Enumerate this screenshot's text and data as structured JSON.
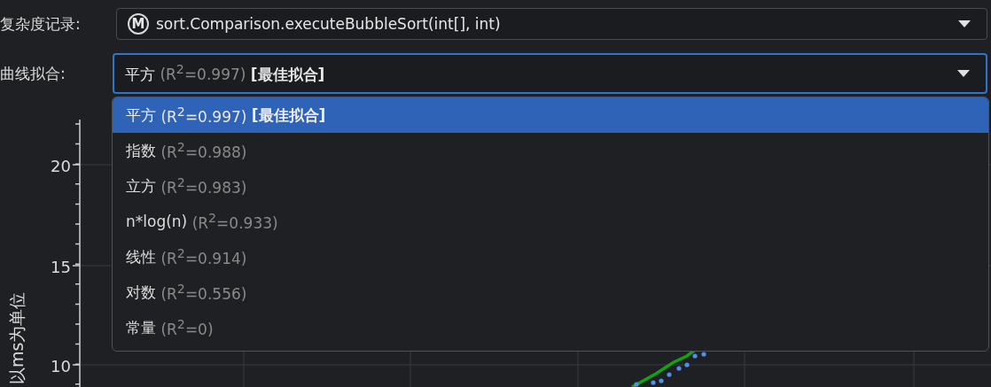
{
  "complexity_record": {
    "label": "复杂度记录:",
    "icon_letter": "M",
    "value": "sort.Comparison.executeBubbleSort(int[], int)"
  },
  "curve_fit": {
    "label": "曲线拟合:",
    "focused": true,
    "value": {
      "name": "平方",
      "fit": "(R$^{2}$=0.997)",
      "tag": "[最佳拟合]"
    },
    "options": [
      {
        "name": "平方",
        "fit": "(R$^{2}$=0.997)",
        "tag": "[最佳拟合]",
        "selected": true
      },
      {
        "name": "指数",
        "fit": "(R$^{2}$=0.988)",
        "selected": false
      },
      {
        "name": "立方",
        "fit": "(R$^{2}$=0.983)",
        "selected": false
      },
      {
        "name": "n*log(n)",
        "fit": "(R$^{2}$=0.933)",
        "selected": false
      },
      {
        "name": "线性",
        "fit": "(R$^{2}$=0.914)",
        "selected": false
      },
      {
        "name": "对数",
        "fit": "(R$^{2}$=0.556)",
        "selected": false
      },
      {
        "name": "常量",
        "fit": "(R$^{2}$=0)",
        "selected": false
      }
    ]
  },
  "chart": {
    "ylabel": "以ms为单位",
    "ytick_labels": [
      "20",
      "15",
      "10"
    ]
  }
}
